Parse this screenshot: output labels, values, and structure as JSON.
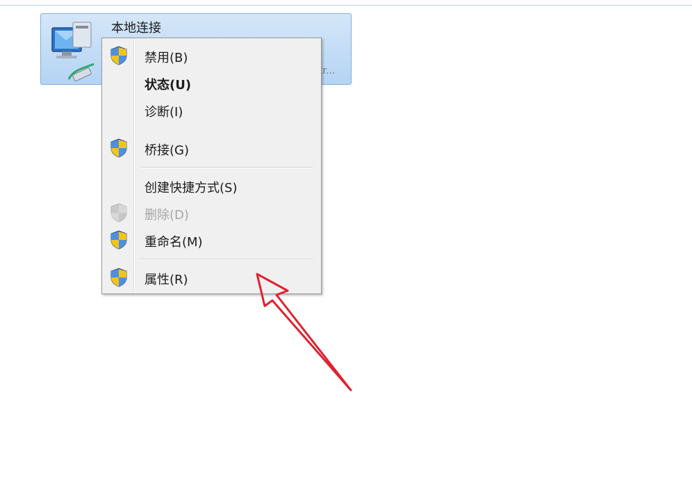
{
  "connection": {
    "name": "本地连接",
    "description_fragment": "tr..."
  },
  "context_menu": {
    "items": [
      {
        "label": "禁用(B)",
        "icon": "uac-shield-icon"
      },
      {
        "label": "状态(U)",
        "icon": ""
      },
      {
        "label": "诊断(I)",
        "icon": ""
      },
      {
        "label": "桥接(G)",
        "icon": "uac-shield-icon"
      },
      {
        "label": "创建快捷方式(S)",
        "icon": ""
      },
      {
        "label": "删除(D)",
        "icon": "uac-shield-disabled-icon"
      },
      {
        "label": "重命名(M)",
        "icon": "uac-shield-icon"
      },
      {
        "label": "属性(R)",
        "icon": "uac-shield-icon"
      }
    ],
    "default_item": "状态(U)",
    "disabled_item": "删除(D)"
  },
  "colors": {
    "annotation_arrow": "#e0212f",
    "selection_tile": "#c2dcf6",
    "menu_background": "#f0f0f0"
  }
}
